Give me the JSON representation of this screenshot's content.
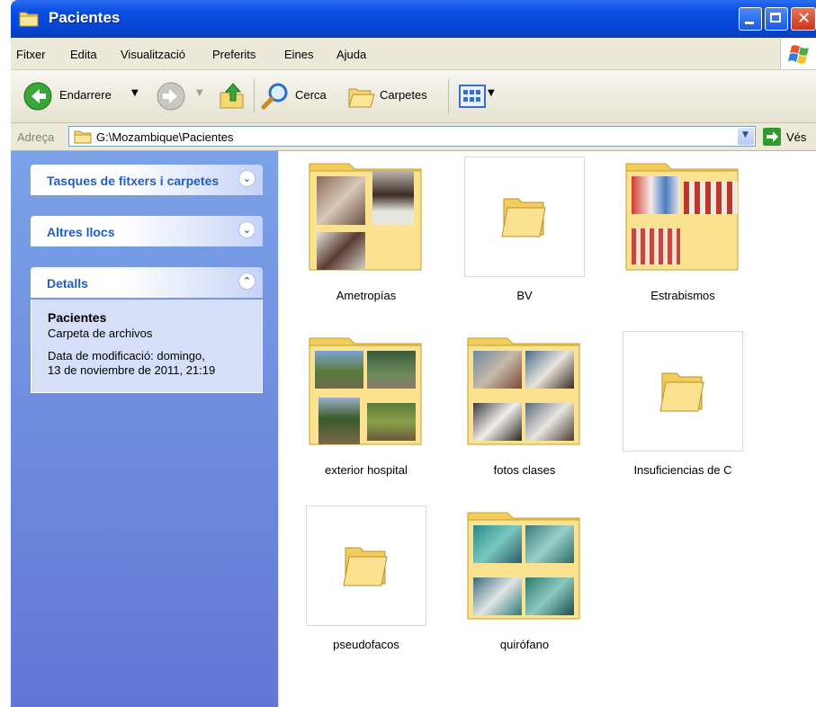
{
  "window": {
    "title": "Pacientes"
  },
  "menubar": {
    "items": [
      "Fitxer",
      "Edita",
      "Visualització",
      "Preferits",
      "Eines",
      "Ajuda"
    ]
  },
  "toolbar": {
    "back_label": "Endarrere",
    "search_label": "Cerca",
    "folders_label": "Carpetes"
  },
  "address": {
    "label": "Adreça",
    "path": "G:\\Mozambique\\Pacientes",
    "go_label": "Vés"
  },
  "leftpane": {
    "panels": [
      {
        "title": "Tasques de fitxers i carpetes",
        "expanded": false
      },
      {
        "title": "Altres llocs",
        "expanded": false
      },
      {
        "title": "Detalls",
        "expanded": true
      }
    ],
    "details": {
      "name": "Pacientes",
      "type": "Carpeta de archivos",
      "modified_line1": "Data de modificació: domingo,",
      "modified_line2": "13 de noviembre de 2011, 21:19"
    }
  },
  "folders": [
    {
      "name": "Ametropías",
      "has_preview": true
    },
    {
      "name": "BV",
      "has_preview": false
    },
    {
      "name": "Estrabismos",
      "has_preview": true
    },
    {
      "name": "exterior hospital",
      "has_preview": true
    },
    {
      "name": "fotos clases",
      "has_preview": true
    },
    {
      "name": "Insuficiencias de C",
      "has_preview": false
    },
    {
      "name": "pseudofacos",
      "has_preview": false
    },
    {
      "name": "quirófano",
      "has_preview": true
    }
  ],
  "colors": {
    "accent": "#215dc6",
    "titlebar": "#0a4fe0",
    "folder": "#f5d56e",
    "leftpane": "#6f8ce0"
  }
}
